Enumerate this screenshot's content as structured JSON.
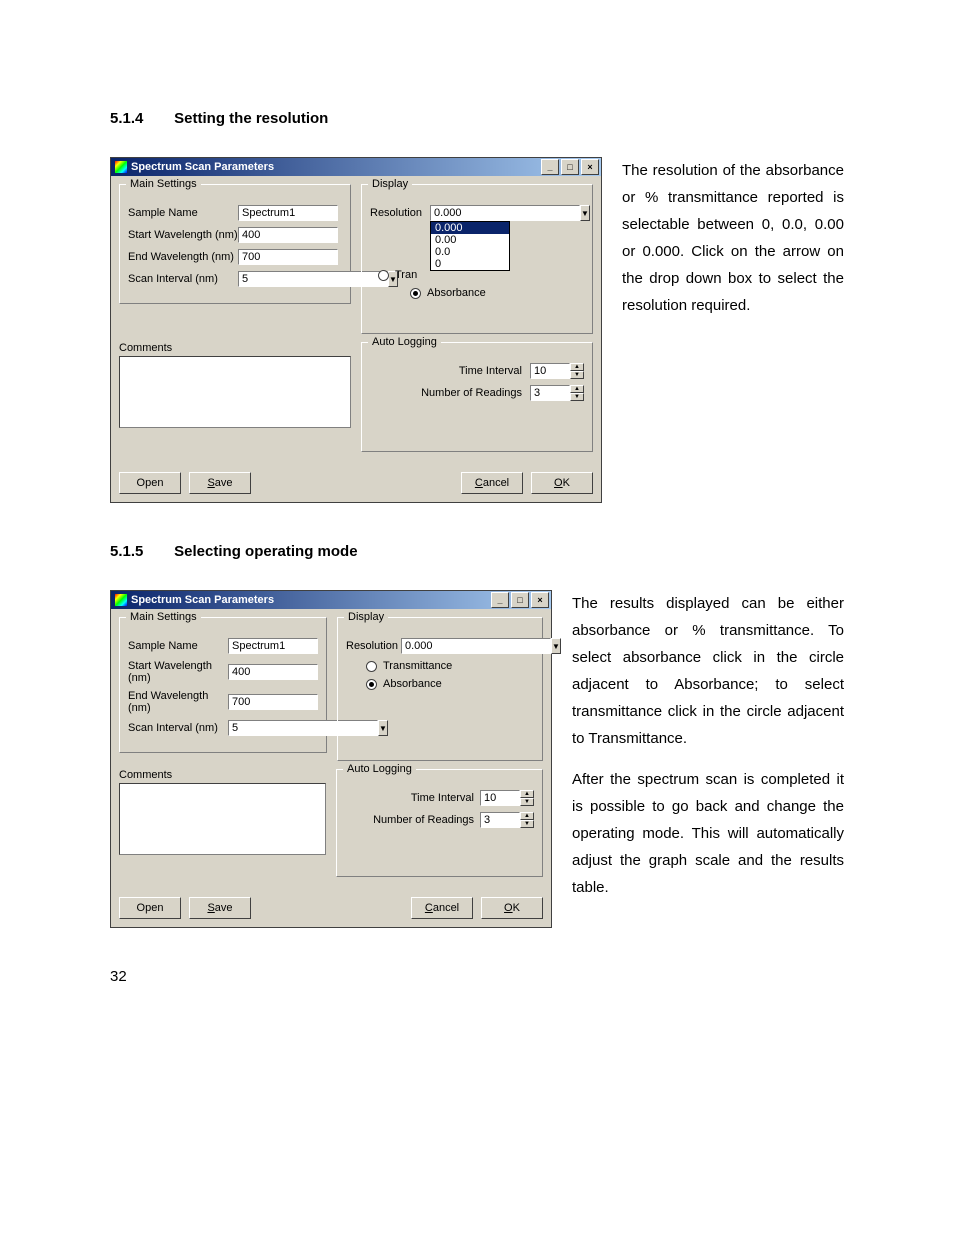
{
  "page_number": "32",
  "section1": {
    "number": "5.1.4",
    "title": "Setting the resolution",
    "para": "The resolution of the absorbance or % transmittance reported is selectable between 0, 0.0, 0.00 or 0.000. Click on the arrow on the drop down box to select the resolution required."
  },
  "section2": {
    "number": "5.1.5",
    "title": "Selecting operating mode",
    "para1": "The results displayed can be either absorbance or % transmittance. To select absorbance click in the circle adjacent to Absorbance; to select transmittance click in the circle adjacent to Transmittance.",
    "para2": "After the spectrum scan is completed it is possible to go back and change the operating mode. This will automatically adjust the graph scale and the results table."
  },
  "dialog": {
    "title": "Spectrum Scan Parameters",
    "main_settings": {
      "legend": "Main Settings",
      "sample_name_label": "Sample Name",
      "sample_name_value": "Spectrum1",
      "start_wl_label": "Start Wavelength (nm)",
      "start_wl_value": "400",
      "end_wl_label": "End Wavelength (nm)",
      "end_wl_value": "700",
      "scan_interval_label": "Scan Interval (nm)",
      "scan_interval_value": "5"
    },
    "display": {
      "legend": "Display",
      "resolution_label": "Resolution",
      "resolution_value": "0.000",
      "resolution_options": [
        "0.000",
        "0.00",
        "0.0",
        "0"
      ],
      "transmittance_label": "Transmittance",
      "absorbance_label": "Absorbance",
      "trans_trunc": "Tran"
    },
    "comments_label": "Comments",
    "auto_logging": {
      "legend": "Auto Logging",
      "time_interval_label": "Time Interval",
      "time_interval_value": "10",
      "num_readings_label": "Number of Readings",
      "num_readings_value": "3"
    },
    "buttons": {
      "open": "Open",
      "save": "Save",
      "cancel": "Cancel",
      "ok": "OK"
    }
  }
}
